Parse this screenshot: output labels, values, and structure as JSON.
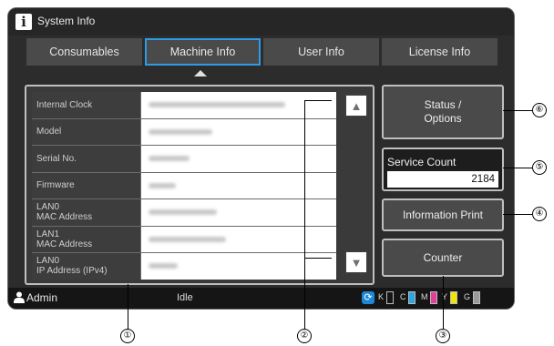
{
  "window": {
    "title": "System Info",
    "title_icon": "info-icon"
  },
  "tabs": [
    {
      "label": "Consumables",
      "active": false
    },
    {
      "label": "Machine Info",
      "active": true
    },
    {
      "label": "User Info",
      "active": false
    },
    {
      "label": "License Info",
      "active": false
    }
  ],
  "table": {
    "rows": [
      {
        "label": "Internal Clock"
      },
      {
        "label": "Model"
      },
      {
        "label": "Serial No."
      },
      {
        "label": "Firmware"
      },
      {
        "label": "LAN0\nMAC Address"
      },
      {
        "label": "LAN1\nMAC Address"
      },
      {
        "label": "LAN0\nIP Address (IPv4)"
      }
    ]
  },
  "scroll": {
    "up_icon": "triangle-up-icon",
    "down_icon": "triangle-down-icon"
  },
  "side": {
    "status_options": "Status /\nOptions",
    "service_count_label": "Service Count",
    "service_count_value": "2184",
    "information_print": "Information Print",
    "counter": "Counter"
  },
  "statusbar": {
    "user": "Admin",
    "status": "Idle",
    "inks": [
      {
        "letter": "K",
        "color": "#2a2a2a",
        "level": 0.0
      },
      {
        "letter": "C",
        "color": "#2aa7e0",
        "level": 1.0
      },
      {
        "letter": "M",
        "color": "#e0409a",
        "level": 1.0
      },
      {
        "letter": "Y",
        "color": "#f2e600",
        "level": 1.0
      },
      {
        "letter": "G",
        "color": "#9a9a9a",
        "level": 1.0
      }
    ]
  },
  "callouts": [
    "①",
    "②",
    "③",
    "④",
    "⑤",
    "⑥"
  ],
  "colors": {
    "accent": "#2d9be6",
    "panel": "#4a4a4a",
    "background": "#2c2c2c"
  }
}
